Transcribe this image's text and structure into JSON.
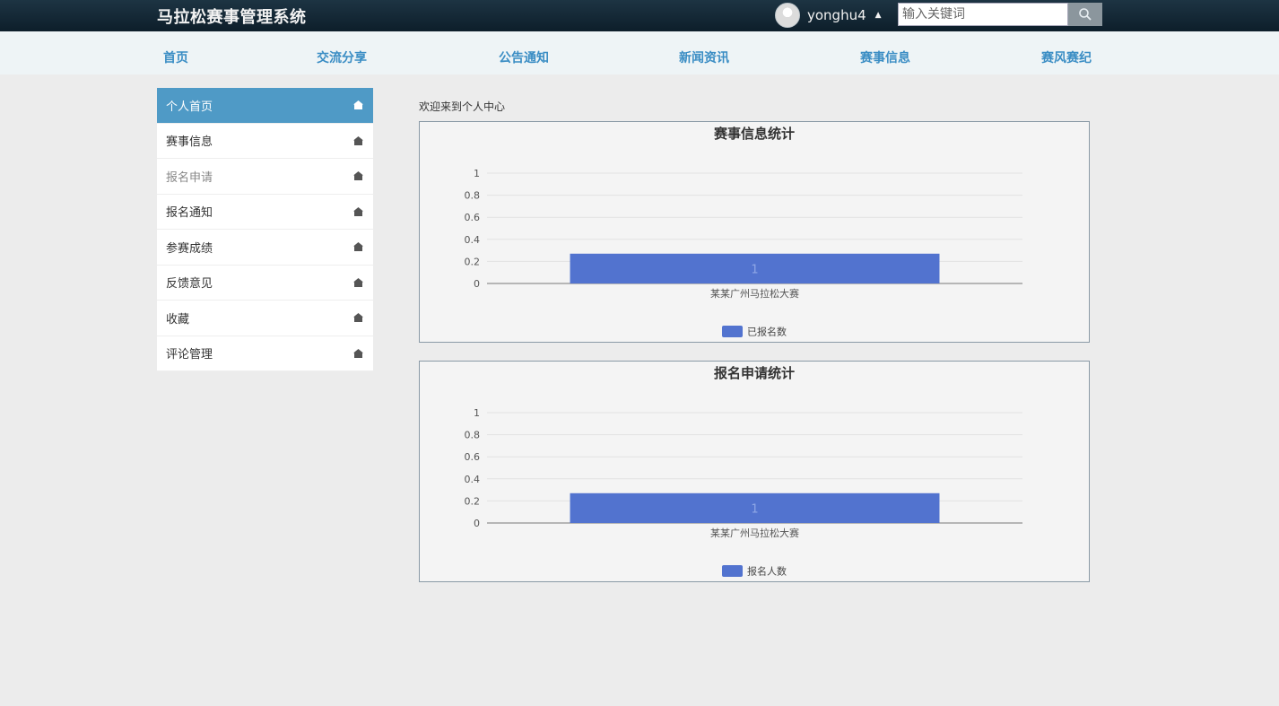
{
  "header": {
    "brand": "马拉松赛事管理系统",
    "username": "yonghu4",
    "search_placeholder": "输入关键词"
  },
  "nav": {
    "items": [
      {
        "label": "首页"
      },
      {
        "label": "交流分享"
      },
      {
        "label": "公告通知"
      },
      {
        "label": "新闻资讯"
      },
      {
        "label": "赛事信息"
      },
      {
        "label": "赛风赛纪"
      }
    ]
  },
  "sidebar": {
    "items": [
      {
        "label": "个人首页"
      },
      {
        "label": "赛事信息"
      },
      {
        "label": "报名申请"
      },
      {
        "label": "报名通知"
      },
      {
        "label": "参赛成绩"
      },
      {
        "label": "反馈意见"
      },
      {
        "label": "收藏"
      },
      {
        "label": "评论管理"
      }
    ]
  },
  "main": {
    "welcome": "欢迎来到个人中心"
  },
  "colors": {
    "bar": "#5273cf",
    "nav_text": "#3a8dc4",
    "active_sidebar": "#4f9ac6"
  },
  "chart_data": [
    {
      "type": "bar",
      "title": "赛事信息统计",
      "categories": [
        "某某广州马拉松大赛"
      ],
      "series": [
        {
          "name": "已报名数",
          "values": [
            1
          ]
        }
      ],
      "ylim": [
        0,
        1
      ],
      "yticks": [
        "0",
        "0.2",
        "0.4",
        "0.6",
        "0.8",
        "1"
      ],
      "grid": true,
      "legend": "bottom"
    },
    {
      "type": "bar",
      "title": "报名申请统计",
      "categories": [
        "某某广州马拉松大赛"
      ],
      "series": [
        {
          "name": "报名人数",
          "values": [
            1
          ]
        }
      ],
      "ylim": [
        0,
        1
      ],
      "yticks": [
        "0",
        "0.2",
        "0.4",
        "0.6",
        "0.8",
        "1"
      ],
      "grid": true,
      "legend": "bottom"
    }
  ]
}
